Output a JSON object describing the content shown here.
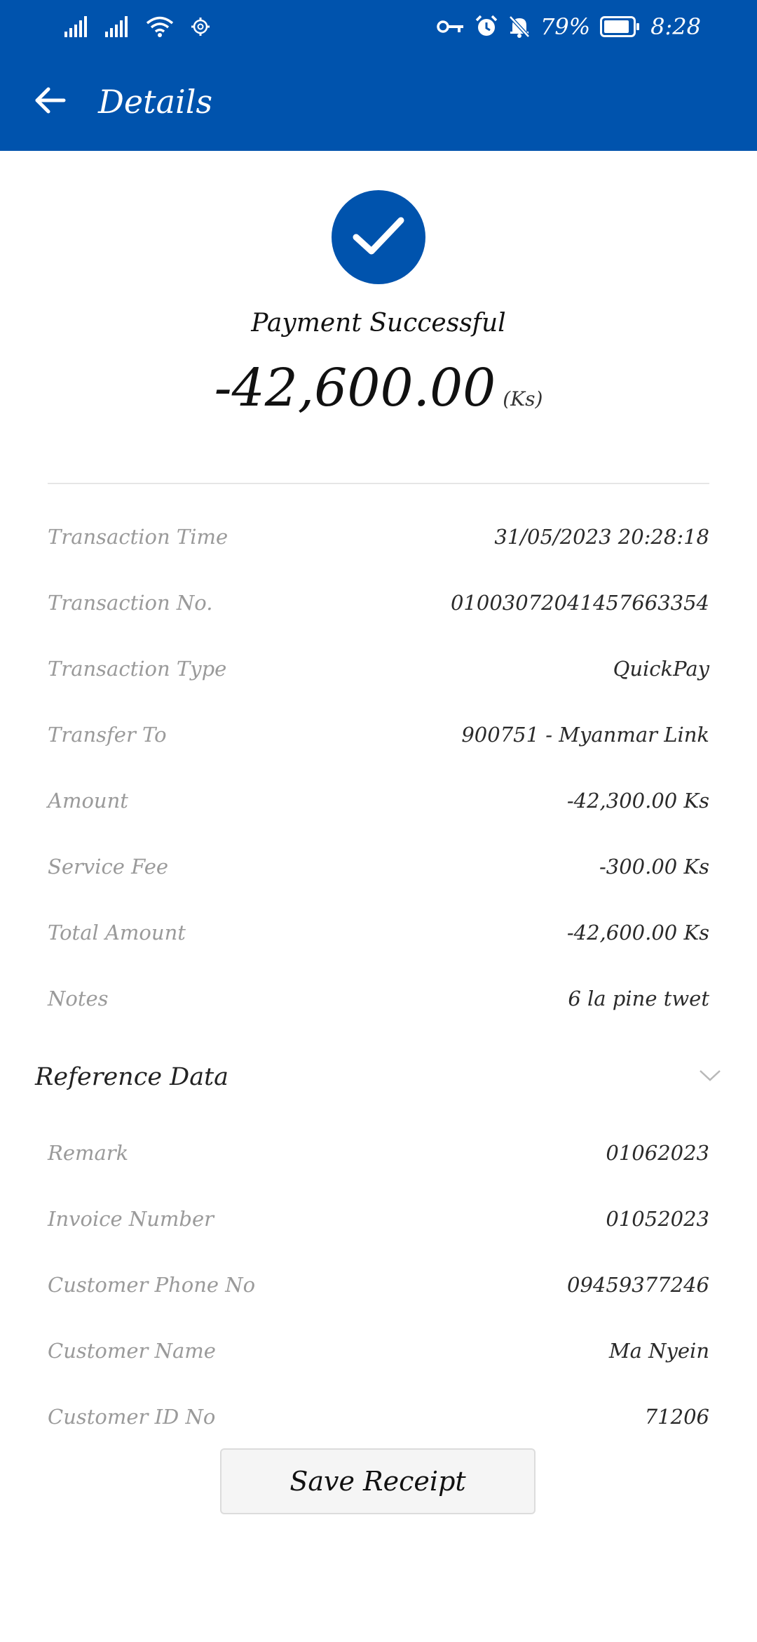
{
  "status_bar": {
    "battery": "79%",
    "time": "8:28"
  },
  "header": {
    "title": "Details"
  },
  "payment": {
    "status": "Payment Successful",
    "amount": "-42,600.00",
    "currency": "(Ks)"
  },
  "details": [
    {
      "label": "Transaction Time",
      "value": "31/05/2023 20:28:18"
    },
    {
      "label": "Transaction No.",
      "value": "01003072041457663354"
    },
    {
      "label": "Transaction Type",
      "value": "QuickPay"
    },
    {
      "label": "Transfer To",
      "value": "900751 - Myanmar Link"
    },
    {
      "label": "Amount",
      "value": "-42,300.00 Ks"
    },
    {
      "label": "Service Fee",
      "value": "-300.00 Ks"
    },
    {
      "label": "Total Amount",
      "value": "-42,600.00 Ks"
    },
    {
      "label": "Notes",
      "value": "6 la pine twet"
    }
  ],
  "reference": {
    "title": "Reference Data",
    "rows": [
      {
        "label": "Remark",
        "value": "01062023"
      },
      {
        "label": "Invoice Number",
        "value": "01052023"
      },
      {
        "label": "Customer Phone No",
        "value": "09459377246"
      },
      {
        "label": "Customer Name",
        "value": "Ma Nyein"
      },
      {
        "label": "Customer ID No",
        "value": "71206"
      }
    ]
  },
  "actions": {
    "save_receipt": "Save Receipt"
  },
  "colors": {
    "primary": "#0053ad",
    "label_gray": "#9a9a9a"
  }
}
